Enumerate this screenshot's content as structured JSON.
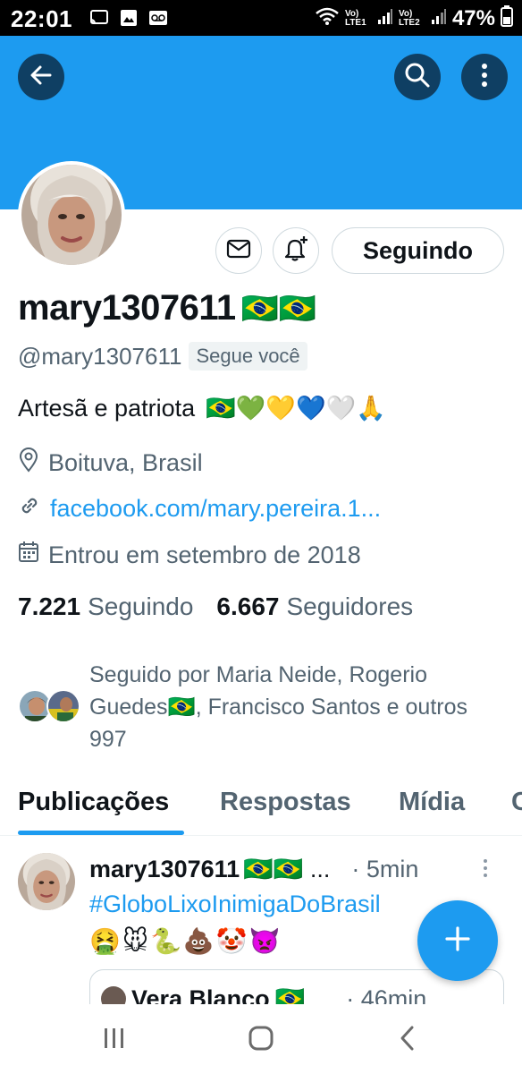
{
  "status_bar": {
    "time": "22:01",
    "battery": "47%",
    "network_1": "Vo) LTE1",
    "network_2": "Vo) LTE2",
    "icons": [
      "cast-icon",
      "image-icon",
      "voicemail-icon",
      "wifi-icon",
      "signal-icon",
      "battery-icon"
    ]
  },
  "header": {
    "back_icon": "arrow-left-icon",
    "search_icon": "search-icon",
    "more_icon": "more-vertical-icon",
    "banner_color": "#1d9bf0"
  },
  "profile": {
    "display_name": "mary1307611",
    "name_emojis": "🇧🇷🇧🇷",
    "handle": "@mary1307611",
    "follows_you": "Segue você",
    "bio_text": "Artesã e patriota",
    "bio_emojis": "🇧🇷💚💛💙🤍🙏",
    "location": "Boituva, Brasil",
    "link": "facebook.com/mary.pereira.1...",
    "joined": "Entrou em setembro de 2018",
    "following_count": "7.221",
    "following_label": "Seguindo",
    "followers_count": "6.667",
    "followers_label": "Seguidores",
    "followed_by": "Seguido por Maria Neide, Rogerio Guedes🇧🇷, Francisco Santos e outros 997"
  },
  "actions": {
    "message_icon": "envelope-icon",
    "notify_icon": "bell-plus-icon",
    "following_button": "Seguindo"
  },
  "tabs": [
    {
      "label": "Publicações",
      "active": true
    },
    {
      "label": "Respostas",
      "active": false
    },
    {
      "label": "Mídia",
      "active": false
    },
    {
      "label": "C",
      "active": false
    }
  ],
  "tweet": {
    "name": "mary1307611",
    "name_emojis": "🇧🇷🇧🇷 ...",
    "time": "· 5min",
    "hashtag": "#GloboLixoInimigaDoBrasil",
    "emojis": "🤮🐭🐍💩🤡👿",
    "quote_name": "Vera Blanco",
    "quote_flag": "🇧🇷",
    "quote_time": "· 46min"
  },
  "fab": {
    "icon": "plus-icon",
    "color": "#1d9bf0"
  },
  "nav": {
    "icons": [
      "recents-icon",
      "home-icon",
      "back-icon"
    ]
  }
}
